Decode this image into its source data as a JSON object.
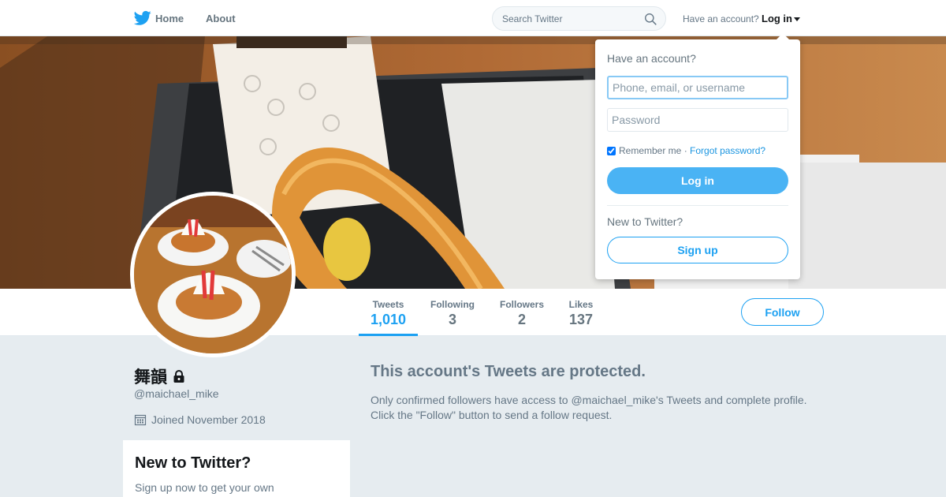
{
  "nav": {
    "home": "Home",
    "about": "About",
    "search_placeholder": "Search Twitter",
    "have_account": "Have an account?",
    "login": "Log in"
  },
  "colors": {
    "accent": "#1da1f2",
    "background": "#e6ecf0"
  },
  "profile": {
    "name": "舞韻",
    "handle": "@maichael_mike",
    "joined": "Joined November 2018"
  },
  "stats": [
    {
      "label": "Tweets",
      "value": "1,010"
    },
    {
      "label": "Following",
      "value": "3"
    },
    {
      "label": "Followers",
      "value": "2"
    },
    {
      "label": "Likes",
      "value": "137"
    }
  ],
  "follow_label": "Follow",
  "protected": {
    "title": "This account's Tweets are protected.",
    "body": "Only confirmed followers have access to @maichael_mike's Tweets and complete profile. Click the \"Follow\" button to send a follow request."
  },
  "new_card": {
    "title": "New to Twitter?",
    "body": "Sign up now to get your own personalized timeline!"
  },
  "login_dropdown": {
    "title": "Have an account?",
    "username_placeholder": "Phone, email, or username",
    "password_placeholder": "Password",
    "remember_label": "Remember me",
    "separator": "·",
    "forgot_label": "Forgot password?",
    "login_button": "Log in",
    "new_label": "New to Twitter?",
    "signup_button": "Sign up"
  }
}
